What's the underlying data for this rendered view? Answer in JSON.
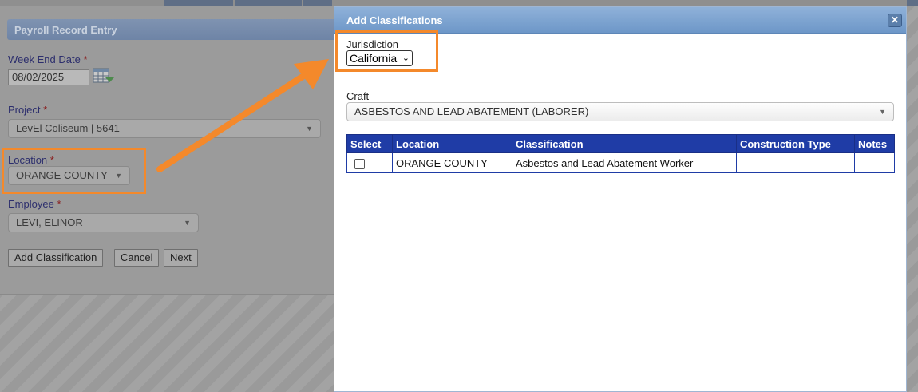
{
  "background_form": {
    "panel_title": "Payroll Record Entry",
    "week_end_date": {
      "label": "Week End Date",
      "required_mark": "*",
      "value": "08/02/2025"
    },
    "project": {
      "label": "Project",
      "required_mark": "*",
      "value": "LevEl Coliseum | 5641"
    },
    "location": {
      "label": "Location",
      "required_mark": "*",
      "value": "ORANGE COUNTY"
    },
    "employee": {
      "label": "Employee",
      "required_mark": "*",
      "value": "LEVI, ELINOR"
    },
    "buttons": {
      "add_classification": "Add Classification",
      "cancel": "Cancel",
      "next": "Next"
    },
    "calendar_icon": "calendar-icon"
  },
  "dialog": {
    "title": "Add Classifications",
    "close_icon": "close-icon",
    "jurisdiction": {
      "label": "Jurisdiction",
      "selected": "California"
    },
    "craft": {
      "label": "Craft",
      "selected": "ASBESTOS AND LEAD ABATEMENT (LABORER)"
    },
    "table": {
      "headers": [
        "Select",
        "Location",
        "Classification",
        "Construction Type",
        "Notes"
      ],
      "rows": [
        {
          "select": false,
          "location": "ORANGE COUNTY",
          "classification": "Asbestos and Lead Abatement Worker",
          "construction_type": "",
          "notes": ""
        }
      ]
    }
  },
  "colors": {
    "highlight": "#f4892b",
    "dialog_title_bg": "#7ba3d1",
    "table_header_bg": "#1f3ca6"
  }
}
